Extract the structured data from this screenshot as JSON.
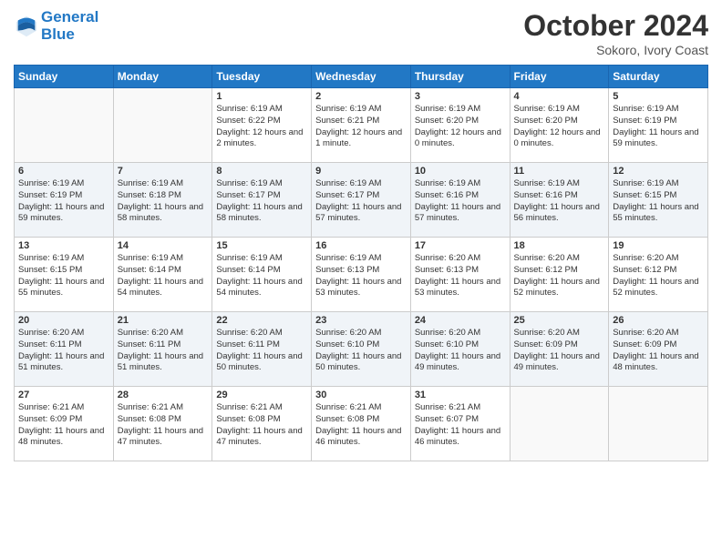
{
  "header": {
    "logo_line1": "General",
    "logo_line2": "Blue",
    "month": "October 2024",
    "location": "Sokoro, Ivory Coast"
  },
  "weekdays": [
    "Sunday",
    "Monday",
    "Tuesday",
    "Wednesday",
    "Thursday",
    "Friday",
    "Saturday"
  ],
  "weeks": [
    [
      {
        "day": "",
        "text": ""
      },
      {
        "day": "",
        "text": ""
      },
      {
        "day": "1",
        "text": "Sunrise: 6:19 AM\nSunset: 6:22 PM\nDaylight: 12 hours and 2 minutes."
      },
      {
        "day": "2",
        "text": "Sunrise: 6:19 AM\nSunset: 6:21 PM\nDaylight: 12 hours and 1 minute."
      },
      {
        "day": "3",
        "text": "Sunrise: 6:19 AM\nSunset: 6:20 PM\nDaylight: 12 hours and 0 minutes."
      },
      {
        "day": "4",
        "text": "Sunrise: 6:19 AM\nSunset: 6:20 PM\nDaylight: 12 hours and 0 minutes."
      },
      {
        "day": "5",
        "text": "Sunrise: 6:19 AM\nSunset: 6:19 PM\nDaylight: 11 hours and 59 minutes."
      }
    ],
    [
      {
        "day": "6",
        "text": "Sunrise: 6:19 AM\nSunset: 6:19 PM\nDaylight: 11 hours and 59 minutes."
      },
      {
        "day": "7",
        "text": "Sunrise: 6:19 AM\nSunset: 6:18 PM\nDaylight: 11 hours and 58 minutes."
      },
      {
        "day": "8",
        "text": "Sunrise: 6:19 AM\nSunset: 6:17 PM\nDaylight: 11 hours and 58 minutes."
      },
      {
        "day": "9",
        "text": "Sunrise: 6:19 AM\nSunset: 6:17 PM\nDaylight: 11 hours and 57 minutes."
      },
      {
        "day": "10",
        "text": "Sunrise: 6:19 AM\nSunset: 6:16 PM\nDaylight: 11 hours and 57 minutes."
      },
      {
        "day": "11",
        "text": "Sunrise: 6:19 AM\nSunset: 6:16 PM\nDaylight: 11 hours and 56 minutes."
      },
      {
        "day": "12",
        "text": "Sunrise: 6:19 AM\nSunset: 6:15 PM\nDaylight: 11 hours and 55 minutes."
      }
    ],
    [
      {
        "day": "13",
        "text": "Sunrise: 6:19 AM\nSunset: 6:15 PM\nDaylight: 11 hours and 55 minutes."
      },
      {
        "day": "14",
        "text": "Sunrise: 6:19 AM\nSunset: 6:14 PM\nDaylight: 11 hours and 54 minutes."
      },
      {
        "day": "15",
        "text": "Sunrise: 6:19 AM\nSunset: 6:14 PM\nDaylight: 11 hours and 54 minutes."
      },
      {
        "day": "16",
        "text": "Sunrise: 6:19 AM\nSunset: 6:13 PM\nDaylight: 11 hours and 53 minutes."
      },
      {
        "day": "17",
        "text": "Sunrise: 6:20 AM\nSunset: 6:13 PM\nDaylight: 11 hours and 53 minutes."
      },
      {
        "day": "18",
        "text": "Sunrise: 6:20 AM\nSunset: 6:12 PM\nDaylight: 11 hours and 52 minutes."
      },
      {
        "day": "19",
        "text": "Sunrise: 6:20 AM\nSunset: 6:12 PM\nDaylight: 11 hours and 52 minutes."
      }
    ],
    [
      {
        "day": "20",
        "text": "Sunrise: 6:20 AM\nSunset: 6:11 PM\nDaylight: 11 hours and 51 minutes."
      },
      {
        "day": "21",
        "text": "Sunrise: 6:20 AM\nSunset: 6:11 PM\nDaylight: 11 hours and 51 minutes."
      },
      {
        "day": "22",
        "text": "Sunrise: 6:20 AM\nSunset: 6:11 PM\nDaylight: 11 hours and 50 minutes."
      },
      {
        "day": "23",
        "text": "Sunrise: 6:20 AM\nSunset: 6:10 PM\nDaylight: 11 hours and 50 minutes."
      },
      {
        "day": "24",
        "text": "Sunrise: 6:20 AM\nSunset: 6:10 PM\nDaylight: 11 hours and 49 minutes."
      },
      {
        "day": "25",
        "text": "Sunrise: 6:20 AM\nSunset: 6:09 PM\nDaylight: 11 hours and 49 minutes."
      },
      {
        "day": "26",
        "text": "Sunrise: 6:20 AM\nSunset: 6:09 PM\nDaylight: 11 hours and 48 minutes."
      }
    ],
    [
      {
        "day": "27",
        "text": "Sunrise: 6:21 AM\nSunset: 6:09 PM\nDaylight: 11 hours and 48 minutes."
      },
      {
        "day": "28",
        "text": "Sunrise: 6:21 AM\nSunset: 6:08 PM\nDaylight: 11 hours and 47 minutes."
      },
      {
        "day": "29",
        "text": "Sunrise: 6:21 AM\nSunset: 6:08 PM\nDaylight: 11 hours and 47 minutes."
      },
      {
        "day": "30",
        "text": "Sunrise: 6:21 AM\nSunset: 6:08 PM\nDaylight: 11 hours and 46 minutes."
      },
      {
        "day": "31",
        "text": "Sunrise: 6:21 AM\nSunset: 6:07 PM\nDaylight: 11 hours and 46 minutes."
      },
      {
        "day": "",
        "text": ""
      },
      {
        "day": "",
        "text": ""
      }
    ]
  ]
}
